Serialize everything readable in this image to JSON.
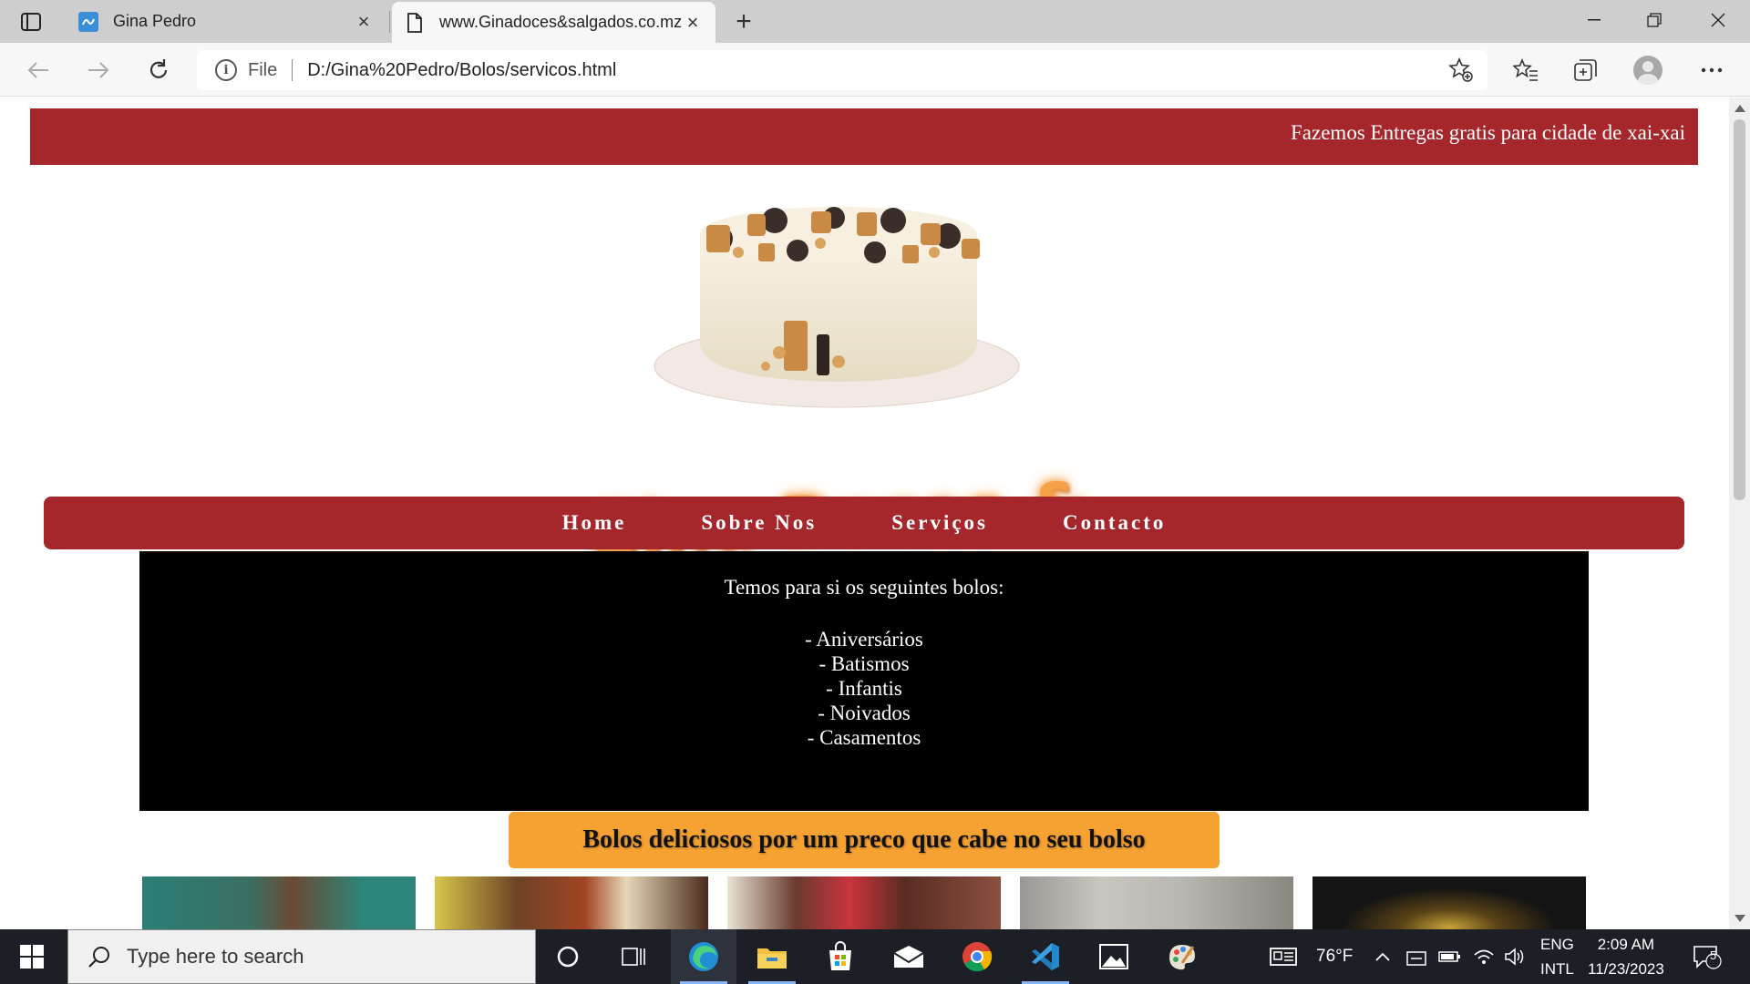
{
  "browser": {
    "tabs": [
      {
        "title": "Gina Pedro",
        "active": false
      },
      {
        "title": "www.Ginadoces&salgados.co.mz",
        "active": true
      }
    ],
    "address": {
      "scheme_label": "File",
      "url": "D:/Gina%20Pedro/Bolos/servicos.html"
    }
  },
  "page": {
    "marquee": "Fazemos Entregas gratis para cidade de xai-xai",
    "logo_text": "Gina Doces & Salgados",
    "nav": [
      {
        "label": "Home"
      },
      {
        "label": "Sobre Nos"
      },
      {
        "label": "Serviços"
      },
      {
        "label": "Contacto"
      }
    ],
    "info": {
      "intro": "Temos para si os seguintes bolos:",
      "items": [
        "- Aniversários",
        "- Batismos",
        "- Infantis",
        "- Noivados",
        "- Casamentos"
      ]
    },
    "tagline": "Bolos deliciosos por um preco que cabe no seu bolso"
  },
  "taskbar": {
    "search_placeholder": "Type here to search",
    "weather": "76°F",
    "lang_top": "ENG",
    "lang_bottom": "INTL",
    "time": "2:09 AM",
    "date": "11/23/2023",
    "notification_count": "5"
  },
  "colors": {
    "brand_red": "#a5272c",
    "accent_orange": "#f5a233"
  }
}
